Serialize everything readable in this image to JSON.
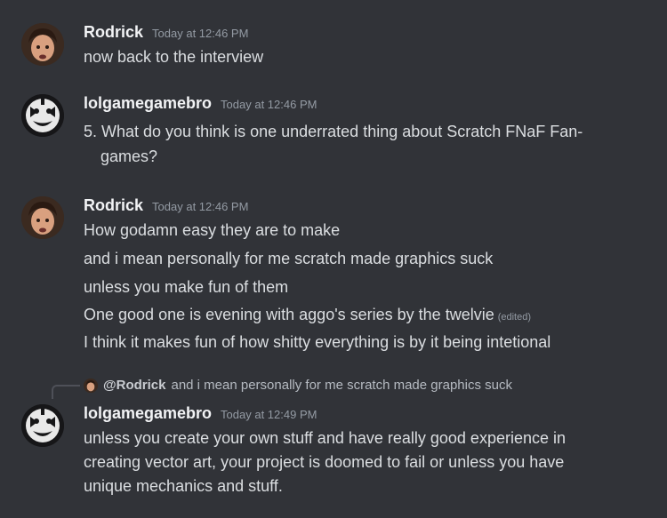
{
  "messages": [
    {
      "author": "Rodrick",
      "time": "Today at 12:46 PM",
      "lines": [
        "now back to the interview"
      ]
    },
    {
      "author": "lolgamegamebro",
      "time": "Today at 12:46 PM",
      "lines": [
        "5. What do you think is one underrated thing about Scratch FNaF Fan-",
        "games?"
      ]
    },
    {
      "author": "Rodrick",
      "time": "Today at 12:46 PM",
      "lines": [
        "How godamn easy they are to make",
        "and i mean personally for me scratch made graphics suck",
        "unless you make fun of them",
        "One good one is evening with aggo's series by the twelvie",
        "I think it makes fun of how shitty everything is by it being intetional"
      ],
      "edited_label": "(edited)"
    },
    {
      "author": "lolgamegamebro",
      "time": "Today at 12:49 PM",
      "reply": {
        "mention": "@Rodrick",
        "text": "and i mean personally for me scratch made graphics suck"
      },
      "lines": [
        "unless you create your own stuff and have really good experience in",
        "creating vector art, your project is doomed to fail or unless you have",
        "unique mechanics and stuff."
      ]
    }
  ]
}
